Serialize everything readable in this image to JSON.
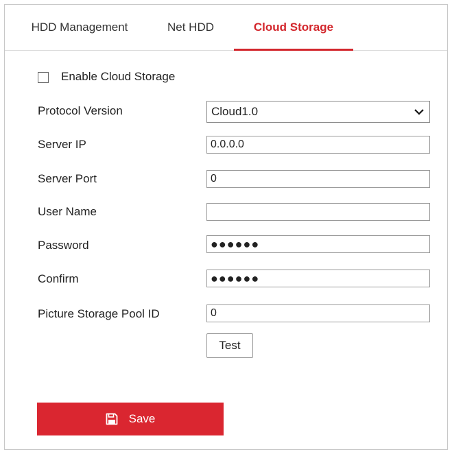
{
  "tabs": [
    {
      "label": "HDD Management",
      "active": false
    },
    {
      "label": "Net HDD",
      "active": false
    },
    {
      "label": "Cloud Storage",
      "active": true
    }
  ],
  "enable": {
    "label": "Enable Cloud Storage",
    "checked": false
  },
  "protocol": {
    "label": "Protocol Version",
    "value": "Cloud1.0"
  },
  "server_ip": {
    "label": "Server IP",
    "value": "0.0.0.0"
  },
  "server_port": {
    "label": "Server Port",
    "value": "0"
  },
  "user_name": {
    "label": "User Name",
    "value": ""
  },
  "password": {
    "label": "Password",
    "value": "●●●●●●"
  },
  "confirm": {
    "label": "Confirm",
    "value": "●●●●●●"
  },
  "pool_id": {
    "label": "Picture Storage Pool ID",
    "value": "0"
  },
  "test_label": "Test",
  "save_label": "Save",
  "colors": {
    "accent": "#d3262c",
    "save_bg": "#da2630"
  },
  "icons": {
    "save": "floppy-disk-icon",
    "dropdown": "chevron-down-icon"
  }
}
